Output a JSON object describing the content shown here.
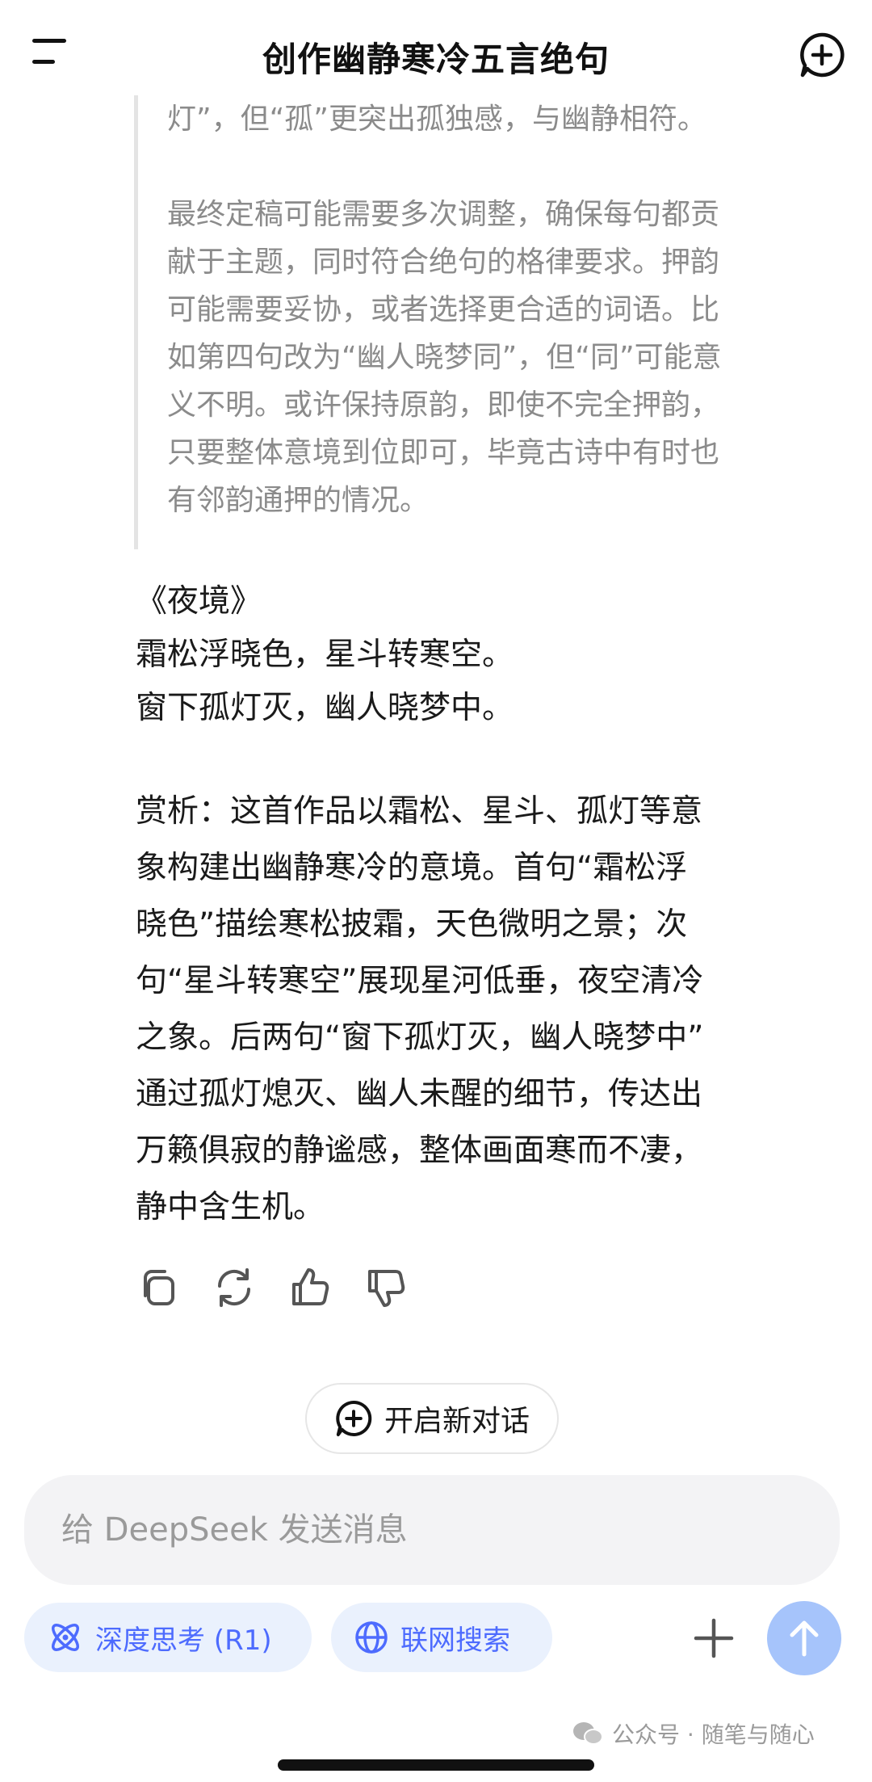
{
  "header": {
    "title": "创作幽静寒冷五言绝句"
  },
  "thinking": {
    "paragraphs": [
      "灯”，但“孤”更突出孤独感，与幽静相符。",
      "最终定稿可能需要多次调整，确保每句都贡\n献于主题，同时符合绝句的格律要求。押韵\n可能需要妥协，或者选择更合适的词语。比\n如第四句改为“幽人晓梦同”，但“同”可能意\n义不明。或许保持原韵，即使不完全押韵，\n只要整体意境到位即可，毕竟古诗中有时也\n有邻韵通押的情况。"
    ]
  },
  "answer": {
    "poem_title": "《夜境》",
    "poem_line1": "霜松浮晓色，星斗转寒空。",
    "poem_line2": "窗下孤灯灭，幽人晓梦中。",
    "analysis": "赏析：这首作品以霜松、星斗、孤灯等意\n象构建出幽静寒冷的意境。首句“霜松浮\n晓色”描绘寒松披霜，天色微明之景；次\n句“星斗转寒空”展现星河低垂，夜空清冷\n之象。后两句“窗下孤灯灭，幽人晓梦中”\n通过孤灯熄灭、幽人未醒的细节，传达出\n万籁俱寂的静谧感，整体画面寒而不凄，\n静中含生机。"
  },
  "actions": {
    "icons": [
      "copy-icon",
      "regenerate-icon",
      "thumbs-up-icon",
      "thumbs-down-icon"
    ]
  },
  "new_chat": {
    "label": "开启新对话"
  },
  "composer": {
    "placeholder": "给 DeepSeek 发送消息",
    "value": ""
  },
  "chips": {
    "deep_think": "深度思考 (R1)",
    "web_search": "联网搜索"
  },
  "watermark": {
    "text": "公众号 · 随笔与随心"
  },
  "colors": {
    "accent": "#4d6bfe",
    "chip_bg": "#eaf1fd",
    "send_button": "#a6c4fb",
    "thinking_text": "#8b8b8b",
    "composer_bg": "#f3f3f5"
  }
}
